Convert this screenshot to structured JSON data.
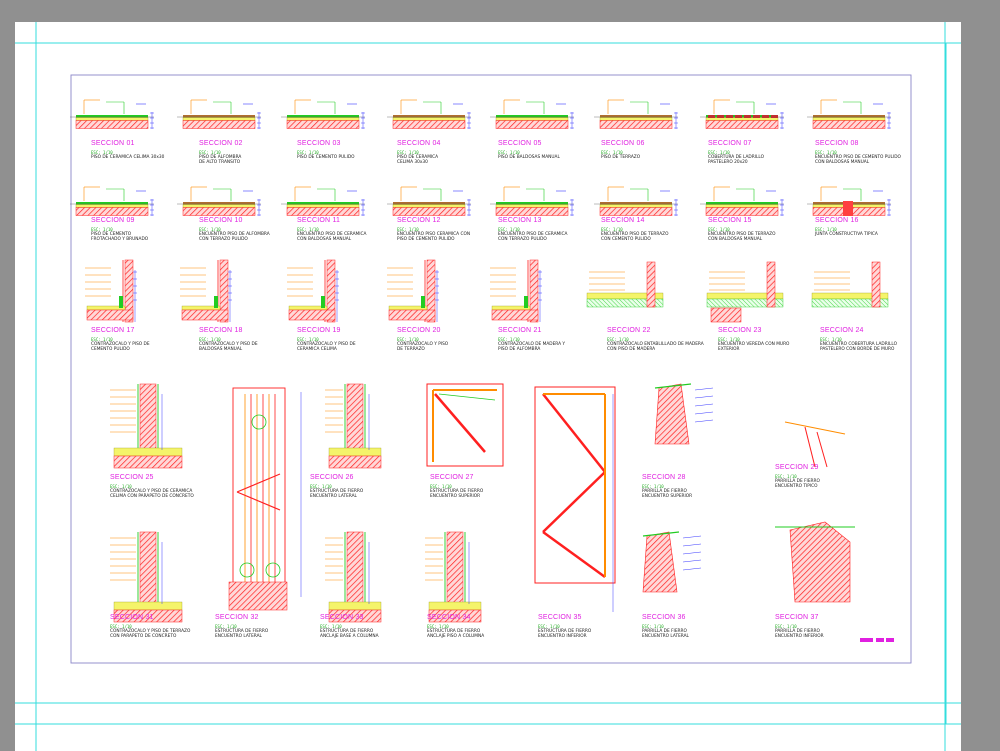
{
  "colors": {
    "background": "#909090",
    "sheet": "#ffffff",
    "frame": "#33dddd",
    "border": "#8a87c8",
    "title": "#e020e0",
    "hatch": "#ff2020",
    "fill_yellow": "#f4f46a",
    "green": "#22cc22",
    "dim": "#3a3aff",
    "orange": "#ff8c00"
  },
  "sections": [
    {
      "label": "SECCION 01",
      "scale": "ESC: 1/10",
      "desc": "PISO DE CERAMICA CELIMA 30x30"
    },
    {
      "label": "SECCION 02",
      "scale": "ESC: 1/10",
      "desc": "PISO DE ALFOMBRA\nDE ALTO TRANSITO"
    },
    {
      "label": "SECCION 03",
      "scale": "ESC: 1/10",
      "desc": "PISO DE CEMENTO PULIDO"
    },
    {
      "label": "SECCION 04",
      "scale": "ESC: 1/10",
      "desc": "PISO DE CERAMICA\nCELIMA 30x30"
    },
    {
      "label": "SECCION 05",
      "scale": "ESC: 1/10",
      "desc": "PISO DE BALDOSAS MANUAL"
    },
    {
      "label": "SECCION 06",
      "scale": "ESC: 1/10",
      "desc": "PISO DE TERRAZO"
    },
    {
      "label": "SECCION 07",
      "scale": "ESC: 1/10",
      "desc": "COBERTURA DE LADRILLO\nPASTELERO 20x20"
    },
    {
      "label": "SECCION 08",
      "scale": "ESC: 1/10",
      "desc": "ENCUENTRO PISO DE CEMENTO PULIDO\nCON BALDOSAS MANUAL"
    },
    {
      "label": "SECCION 09",
      "scale": "ESC: 1/10",
      "desc": "PISO DE CEMENTO\nFROTACHADO Y BRUNADO"
    },
    {
      "label": "SECCION 10",
      "scale": "ESC: 1/10",
      "desc": "ENCUENTRO PISO DE ALFOMBRA\nCON TERRAZO PULIDO"
    },
    {
      "label": "SECCION 11",
      "scale": "ESC: 1/10",
      "desc": "ENCUENTRO PISO DE CERAMICA\nCON BALDOSAS MANUAL"
    },
    {
      "label": "SECCION 12",
      "scale": "ESC: 1/10",
      "desc": "ENCUENTRO PISO CERAMICA CON\nPISO DE CEMENTO PULIDO"
    },
    {
      "label": "SECCION 13",
      "scale": "ESC: 1/10",
      "desc": "ENCUENTRO PISO DE CERAMICA\nCON TERRAZO PULIDO"
    },
    {
      "label": "SECCION 14",
      "scale": "ESC: 1/10",
      "desc": "ENCUENTRO PISO DE TERRAZO\nCON CEMENTO PULIDO"
    },
    {
      "label": "SECCION 15",
      "scale": "ESC: 1/10",
      "desc": "ENCUENTRO PISO DE TERRAZO\nCON BALDOSAS MANUAL"
    },
    {
      "label": "SECCION 16",
      "scale": "ESC: 1/10",
      "desc": "JUNTA CONSTRUCTIVA TIPICA"
    },
    {
      "label": "SECCION 17",
      "scale": "ESC: 1/10",
      "desc": "CONTRAZOCALO Y PISO DE\nCEMENTO PULIDO"
    },
    {
      "label": "SECCION 18",
      "scale": "ESC: 1/10",
      "desc": "CONTRAZOCALO Y PISO DE\nBALDOSAS MANUAL"
    },
    {
      "label": "SECCION 19",
      "scale": "ESC: 1/10",
      "desc": "CONTRAZOCALO Y PISO DE\nCERAMICA CELIMA"
    },
    {
      "label": "SECCION 20",
      "scale": "ESC: 1/10",
      "desc": "CONTRAZOCALO Y PISO\nDE TERRAZO"
    },
    {
      "label": "SECCION 21",
      "scale": "ESC: 1/10",
      "desc": "CONTRAZOCALO DE MADERA Y\nPISO DE ALFOMBRA"
    },
    {
      "label": "SECCION 22",
      "scale": "ESC: 1/10",
      "desc": "CONTRAZOCALO ENTABLILLADO DE MADERA\nCON PISO DE MADERA"
    },
    {
      "label": "SECCION 23",
      "scale": "ESC: 1/10",
      "desc": "ENCUENTRO VEREDA CON MURO\nEXTERIOR"
    },
    {
      "label": "SECCION 24",
      "scale": "ESC: 1/10",
      "desc": "ENCUENTRO COBERTURA LADRILLO\nPASTELERO CON BORDE DE MURO"
    },
    {
      "label": "SECCION 25",
      "scale": "ESC: 1/10",
      "desc": "CONTRAZOCALO Y PISO DE CERAMICA\nCELIMA CON PARAPETO DE CONCRETO"
    },
    {
      "label": "SECCION 26",
      "scale": "ESC: 1/10",
      "desc": "ESTRUCTURA DE FIERRO\nENCUENTRO LATERAL"
    },
    {
      "label": "SECCION 27",
      "scale": "ESC: 1/10",
      "desc": "ESTRUCTURA DE FIERRO\nENCUENTRO SUPERIOR"
    },
    {
      "label": "SECCION 28",
      "scale": "ESC: 1/10",
      "desc": "PARRILLA DE FIERRO\nENCUENTRO SUPERIOR"
    },
    {
      "label": "SECCION 29",
      "scale": "ESC: 1/10",
      "desc": "PARRILLA DE FIERRO\nENCUENTRO TIPICO"
    },
    {
      "label": "SECCION 31",
      "scale": "ESC: 1/10",
      "desc": "CONTRAZOCALO Y PISO DE TERRAZO\nCON PARAPETO DE CONCRETO"
    },
    {
      "label": "SECCION 32",
      "scale": "ESC: 1/10",
      "desc": "ESTRUCTURA DE FIERRO\nENCUENTRO LATERAL"
    },
    {
      "label": "SECCION 33",
      "scale": "ESC: 1/10",
      "desc": "ESTRUCTURA DE FIERRO\nANCLAJE BASE A COLUMNA"
    },
    {
      "label": "SECCION 34",
      "scale": "ESC: 1/10",
      "desc": "ESTRUCTURA DE FIERRO\nANCLAJE PISO A COLUMNA"
    },
    {
      "label": "SECCION 35",
      "scale": "ESC: 1/10",
      "desc": "ESTRUCTURA DE FIERRO\nENCUENTRO INFERIOR"
    },
    {
      "label": "SECCION 36",
      "scale": "ESC: 1/10",
      "desc": "PARRILLA DE FIERRO\nENCUENTRO LATERAL"
    },
    {
      "label": "SECCION 37",
      "scale": "ESC: 1/10",
      "desc": "PARRILLA DE FIERRO\nENCUENTRO INFERIOR"
    }
  ]
}
